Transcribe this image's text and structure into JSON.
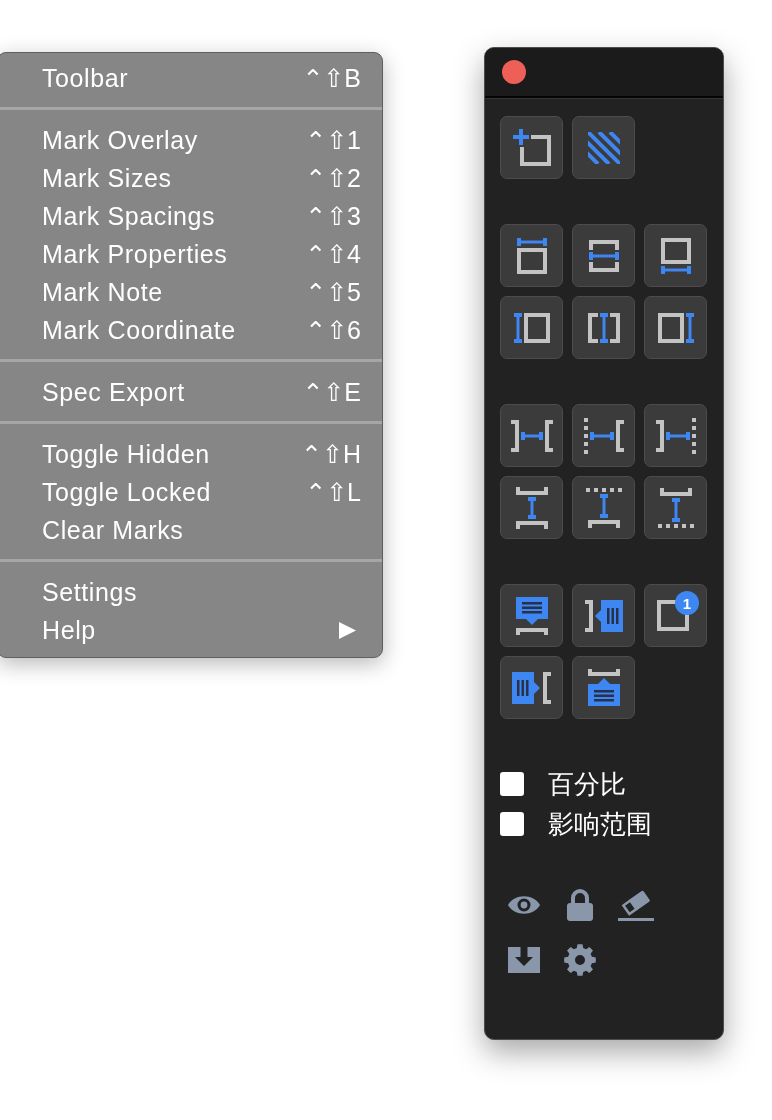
{
  "menu": {
    "sections": [
      {
        "items": [
          {
            "label": "Toolbar",
            "shortcut": "⌃⇧B",
            "submenu": false
          }
        ]
      },
      {
        "items": [
          {
            "label": "Mark Overlay",
            "shortcut": "⌃⇧1",
            "submenu": false
          },
          {
            "label": "Mark Sizes",
            "shortcut": "⌃⇧2",
            "submenu": false
          },
          {
            "label": "Mark Spacings",
            "shortcut": "⌃⇧3",
            "submenu": false
          },
          {
            "label": "Mark Properties",
            "shortcut": "⌃⇧4",
            "submenu": false
          },
          {
            "label": "Mark Note",
            "shortcut": "⌃⇧5",
            "submenu": false
          },
          {
            "label": "Mark Coordinate",
            "shortcut": "⌃⇧6",
            "submenu": false
          }
        ]
      },
      {
        "items": [
          {
            "label": "Spec Export",
            "shortcut": "⌃⇧E",
            "submenu": false
          }
        ]
      },
      {
        "items": [
          {
            "label": "Toggle Hidden",
            "shortcut": "⌃⇧H",
            "submenu": false
          },
          {
            "label": "Toggle Locked",
            "shortcut": "⌃⇧L",
            "submenu": false
          },
          {
            "label": "Clear Marks",
            "submenu": false
          }
        ]
      },
      {
        "items": [
          {
            "label": "Settings",
            "submenu": false
          },
          {
            "label": "Help",
            "submenu": true
          }
        ]
      }
    ]
  },
  "tool_panel": {
    "tool_groups": [
      {
        "buttons": [
          {
            "kind": "add-rect"
          },
          {
            "kind": "hatch"
          }
        ]
      },
      {
        "buttons": [
          {
            "kind": "size-top"
          },
          {
            "kind": "size-middle"
          },
          {
            "kind": "size-bottom"
          },
          {
            "kind": "size-left"
          },
          {
            "kind": "size-center"
          },
          {
            "kind": "size-right"
          }
        ]
      },
      {
        "buttons": [
          {
            "kind": "gap-h"
          },
          {
            "kind": "gap-h-dotted-left"
          },
          {
            "kind": "gap-h-dotted-right"
          },
          {
            "kind": "gap-v"
          },
          {
            "kind": "gap-v-dotted-top"
          },
          {
            "kind": "gap-v-dotted-bottom"
          }
        ]
      },
      {
        "buttons": [
          {
            "kind": "note-top"
          },
          {
            "kind": "note-left"
          },
          {
            "kind": "note-count",
            "badge": "1"
          },
          {
            "kind": "note-right"
          },
          {
            "kind": "note-bottom"
          }
        ]
      }
    ],
    "options": [
      {
        "label": "百分比",
        "checked": false
      },
      {
        "label": "影响范围",
        "checked": false
      }
    ],
    "actions": [
      {
        "kind": "eye"
      },
      {
        "kind": "lock"
      },
      {
        "kind": "eraser"
      },
      {
        "kind": "export"
      },
      {
        "kind": "settings"
      }
    ]
  }
}
